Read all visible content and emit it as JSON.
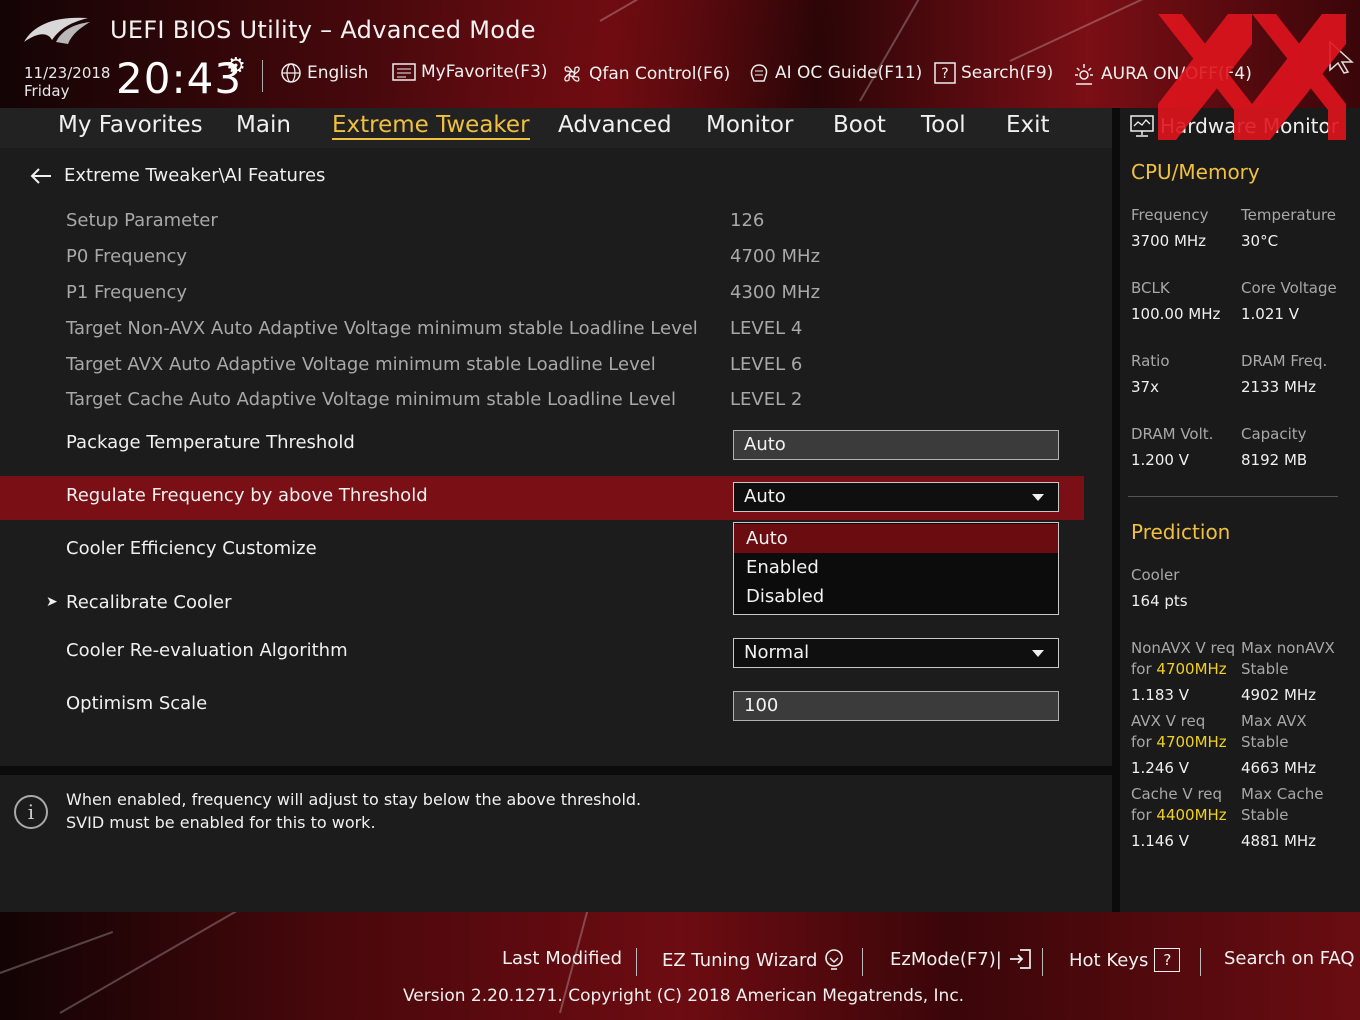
{
  "header": {
    "title": "UEFI BIOS Utility – Advanced Mode",
    "date": "11/23/2018",
    "day": "Friday",
    "time": "20:43",
    "tools": [
      {
        "label": "English",
        "icon": "globe-icon"
      },
      {
        "label": "MyFavorite(F3)",
        "icon": "favorite-icon"
      },
      {
        "label": "Qfan Control(F6)",
        "icon": "fan-icon"
      },
      {
        "label": "AI OC Guide(F11)",
        "icon": "ai-oc-icon"
      },
      {
        "label": "Search(F9)",
        "icon": "search-icon"
      },
      {
        "label": "AURA ON/OFF(F4)",
        "icon": "aura-icon"
      }
    ]
  },
  "menu": {
    "items": [
      "My Favorites",
      "Main",
      "Extreme Tweaker",
      "Advanced",
      "Monitor",
      "Boot",
      "Tool",
      "Exit"
    ],
    "active": "Extreme Tweaker"
  },
  "breadcrumb": "Extreme Tweaker\\AI Features",
  "readonly_rows": [
    {
      "label": "Setup Parameter",
      "value": "126"
    },
    {
      "label": "P0 Frequency",
      "value": "4700 MHz"
    },
    {
      "label": "P1 Frequency",
      "value": "4300 MHz"
    },
    {
      "label": "Target Non-AVX Auto Adaptive Voltage minimum stable Loadline Level",
      "value": "LEVEL 4"
    },
    {
      "label": "Target AVX Auto Adaptive Voltage minimum stable Loadline Level",
      "value": "LEVEL 6"
    },
    {
      "label": "Target Cache Auto Adaptive Voltage minimum stable Loadline Level",
      "value": "LEVEL 2"
    }
  ],
  "settings": {
    "package_temp": {
      "label": "Package Temperature Threshold",
      "value": "Auto"
    },
    "regulate_freq": {
      "label": "Regulate Frequency by above Threshold",
      "value": "Auto"
    },
    "cooler_eff": {
      "label": "Cooler Efficiency Customize"
    },
    "recalibrate": {
      "label": "Recalibrate Cooler"
    },
    "reeval": {
      "label": "Cooler Re-evaluation Algorithm",
      "value": "Normal"
    },
    "optimism": {
      "label": "Optimism Scale",
      "value": "100"
    }
  },
  "dropdown_options": [
    "Auto",
    "Enabled",
    "Disabled"
  ],
  "dropdown_selected": "Auto",
  "info": {
    "line1": "When enabled, frequency will adjust to stay below the above threshold.",
    "line2": "SVID must be enabled for this to work."
  },
  "hw_monitor": {
    "title": "Hardware Monitor",
    "cpu_memory": {
      "heading": "CPU/Memory",
      "items": [
        {
          "label": "Frequency",
          "value": "3700 MHz"
        },
        {
          "label": "Temperature",
          "value": "30°C"
        },
        {
          "label": "BCLK",
          "value": "100.00 MHz"
        },
        {
          "label": "Core Voltage",
          "value": "1.021 V"
        },
        {
          "label": "Ratio",
          "value": "37x"
        },
        {
          "label": "DRAM Freq.",
          "value": "2133 MHz"
        },
        {
          "label": "DRAM Volt.",
          "value": "1.200 V"
        },
        {
          "label": "Capacity",
          "value": "8192 MB"
        }
      ]
    },
    "prediction": {
      "heading": "Prediction",
      "cooler_label": "Cooler",
      "cooler_value": "164 pts",
      "nonavx_req": "NonAVX V req",
      "nonavx_for": "for",
      "nonavx_freq": "4700MHz",
      "nonavx_val": "1.183 V",
      "max_nonavx": "Max nonAVX",
      "max_nonavx_stable": "Stable",
      "max_nonavx_val": "4902 MHz",
      "avx_req": "AVX V req",
      "avx_for": "for",
      "avx_freq": "4700MHz",
      "avx_val": "1.246 V",
      "max_avx": "Max AVX",
      "max_avx_stable": "Stable",
      "max_avx_val": "4663 MHz",
      "cache_req": "Cache V req",
      "cache_for": "for",
      "cache_freq": "4400MHz",
      "cache_val": "1.146 V",
      "max_cache": "Max Cache",
      "max_cache_stable": "Stable",
      "max_cache_val": "4881 MHz"
    }
  },
  "footer": {
    "last_modified": "Last Modified",
    "ez_tuning": "EZ Tuning Wizard",
    "ezmode": "EzMode(F7)|",
    "hot_keys": "Hot Keys",
    "hot_keys_key": "?",
    "search_faq": "Search on FAQ",
    "version": "Version 2.20.1271. Copyright (C) 2018 American Megatrends, Inc."
  },
  "colors": {
    "accent": "#f0c040",
    "highlight": "#7a1015",
    "selected_option": "#6a0c10"
  }
}
